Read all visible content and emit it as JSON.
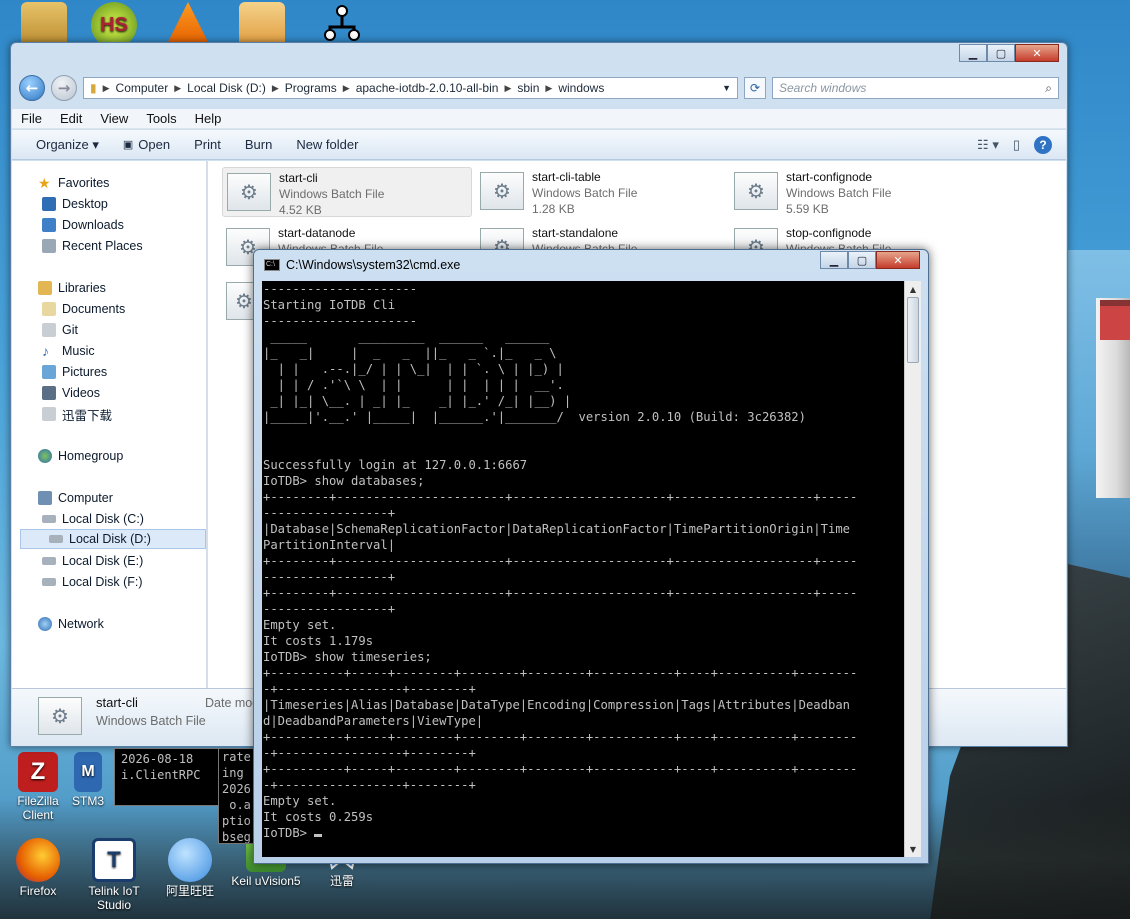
{
  "desktop": {
    "top_icons": [
      "Vmware",
      "HS",
      "VLC",
      "Reader",
      "Network"
    ],
    "bottom_icons": [
      {
        "label": "FileZilla Client",
        "color": "#bf1e1e"
      },
      {
        "label": "STM3",
        "color": "#2d68b0"
      },
      {
        "label": "Firefox",
        "color": "#e66000"
      },
      {
        "label": "Telink IoT Studio",
        "color": "#ffffff"
      },
      {
        "label": "阿里旺旺",
        "color": "#3c8de0"
      },
      {
        "label": "Keil uVision5",
        "color": "#3b8a2e"
      },
      {
        "label": "迅雷",
        "color": "#2e7bd6"
      }
    ],
    "hs_text": "HS"
  },
  "explorer": {
    "address": {
      "crumbs": [
        "Computer",
        "Local Disk (D:)",
        "Programs",
        "apache-iotdb-2.0.10-all-bin",
        "sbin",
        "windows"
      ]
    },
    "search_placeholder": "Search windows",
    "menu": [
      "File",
      "Edit",
      "View",
      "Tools",
      "Help"
    ],
    "toolbar": {
      "organize": "Organize ▾",
      "open": "Open",
      "print": "Print",
      "burn": "Burn",
      "new_folder": "New folder"
    },
    "nav": {
      "favorites": "Favorites",
      "desktop": "Desktop",
      "downloads": "Downloads",
      "recent": "Recent Places",
      "libraries": "Libraries",
      "documents": "Documents",
      "git": "Git",
      "music": "Music",
      "pictures": "Pictures",
      "videos": "Videos",
      "xunlei": "迅雷下载",
      "homegroup": "Homegroup",
      "computer": "Computer",
      "disk_c": "Local Disk (C:)",
      "disk_d": "Local Disk (D:)",
      "disk_e": "Local Disk (E:)",
      "disk_f": "Local Disk (F:)",
      "network": "Network"
    },
    "files": [
      {
        "name": "start-cli",
        "type": "Windows Batch File",
        "size": "4.52 KB"
      },
      {
        "name": "start-cli-table",
        "type": "Windows Batch File",
        "size": "1.28 KB"
      },
      {
        "name": "start-confignode",
        "type": "Windows Batch File",
        "size": "5.59 KB"
      },
      {
        "name": "start-datanode",
        "type": "Windows Batch File",
        "size": ""
      },
      {
        "name": "start-standalone",
        "type": "Windows Batch File",
        "size": ""
      },
      {
        "name": "stop-confignode",
        "type": "Windows Batch File",
        "size": ""
      }
    ],
    "details": {
      "name": "start-cli",
      "type": "Windows Batch File",
      "date_label": "Date mod"
    }
  },
  "bg_console": {
    "lines_left": "2026-08-18\ni.ClientRPC",
    "lines_mid": "rate\ning\n2026\n o.a\nptio\nbseg"
  },
  "cmd": {
    "title": "C:\\Windows\\system32\\cmd.exe",
    "lines": [
      "---------------------",
      "Starting IoTDB Cli",
      "---------------------",
      " _____       _________  ______   ______",
      "|_   _|     |  _   _  ||_   _ `.|_   _ \\",
      "  | |   .--.|_/ | | \\_|  | | `. \\ | |_) |",
      "  | | / .'`\\ \\  | |      | |  | | |  __'.",
      " _| |_| \\__. | _| |_    _| |_.' /_| |__) |",
      "|_____|'.__.' |_____|  |______.'|_______/  version 2.0.10 (Build: 3c26382)",
      "",
      "",
      "Successfully login at 127.0.0.1:6667",
      "IoTDB> show databases;",
      "+--------+-----------------------+---------------------+-------------------+-----",
      "-----------------+",
      "|Database|SchemaReplicationFactor|DataReplicationFactor|TimePartitionOrigin|Time",
      "PartitionInterval|",
      "+--------+-----------------------+---------------------+-------------------+-----",
      "-----------------+",
      "+--------+-----------------------+---------------------+-------------------+-----",
      "-----------------+",
      "Empty set.",
      "It costs 1.179s",
      "IoTDB> show timeseries;",
      "+----------+-----+--------+--------+--------+-----------+----+----------+--------",
      "-+-----------------+--------+",
      "|Timeseries|Alias|Database|DataType|Encoding|Compression|Tags|Attributes|Deadban",
      "d|DeadbandParameters|ViewType|",
      "+----------+-----+--------+--------+--------+-----------+----+----------+--------",
      "-+-----------------+--------+",
      "+----------+-----+--------+--------+--------+-----------+----+----------+--------",
      "-+-----------------+--------+",
      "Empty set.",
      "It costs 0.259s"
    ],
    "prompt": "IoTDB> "
  }
}
